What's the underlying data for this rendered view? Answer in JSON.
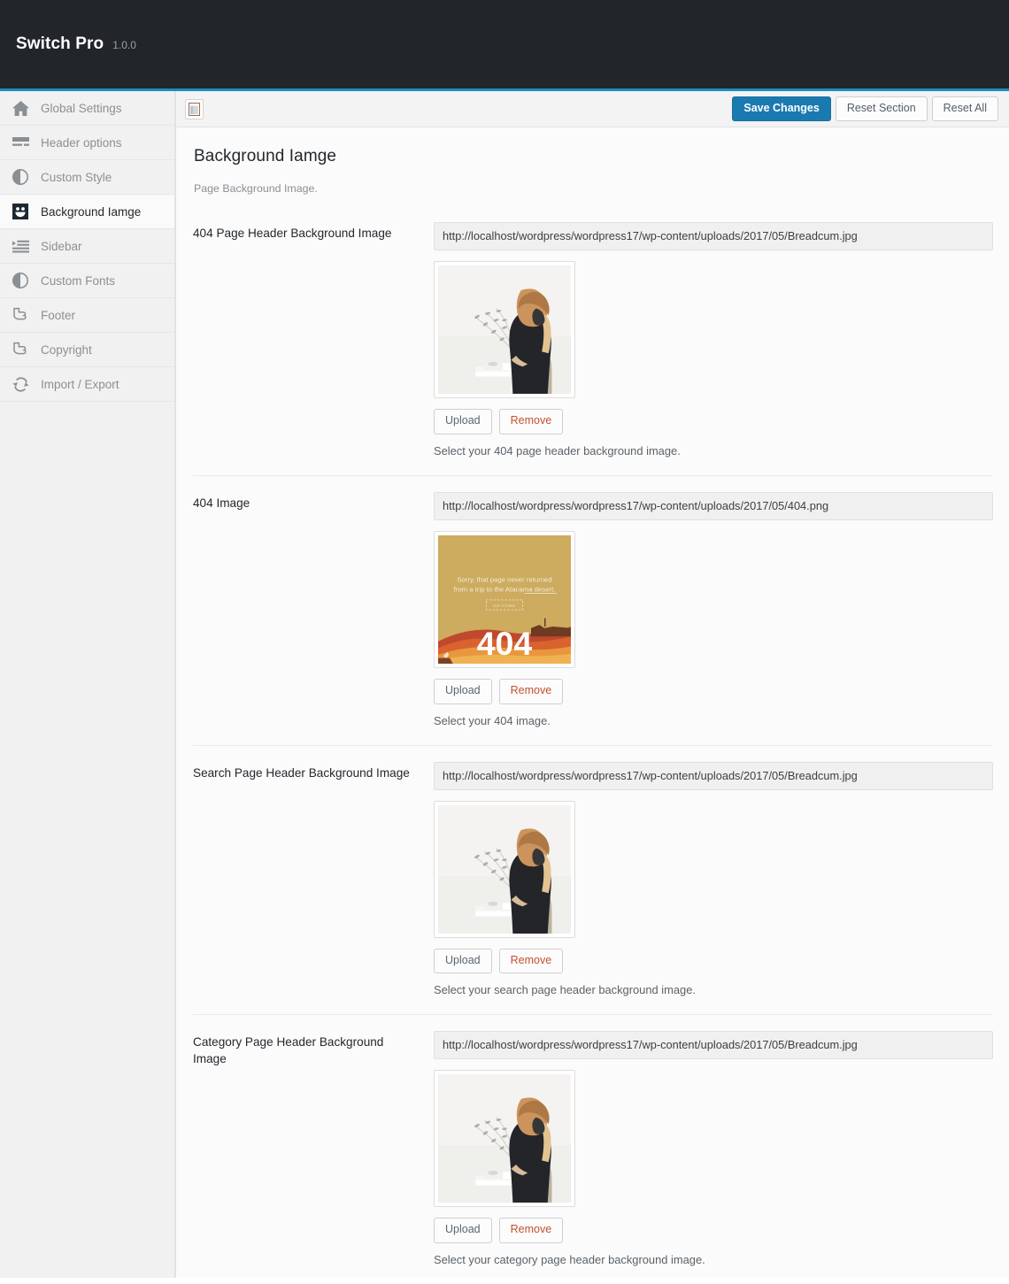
{
  "topbar": {
    "brand": "Switch Pro",
    "version": "1.0.0"
  },
  "colors": {
    "accent": "#1e8cbe",
    "primary_button": "#1a7ab0",
    "topbar_bg": "#22262a",
    "remove_text": "#c2502f",
    "sidebar_bg": "#f1f1f1",
    "content_bg": "#fbfbfb"
  },
  "sidebar": {
    "items": [
      {
        "label": "Global Settings",
        "icon": "home-icon",
        "active": false
      },
      {
        "label": "Header options",
        "icon": "header-bars-icon",
        "active": false
      },
      {
        "label": "Custom Style",
        "icon": "half-circle-icon",
        "active": false
      },
      {
        "label": "Background Iamge",
        "icon": "smiley-square-icon",
        "active": true
      },
      {
        "label": "Sidebar",
        "icon": "indent-list-icon",
        "active": false
      },
      {
        "label": "Custom Fonts",
        "icon": "half-circle-icon",
        "active": false
      },
      {
        "label": "Footer",
        "icon": "pointing-hand-icon",
        "active": false
      },
      {
        "label": "Copyright",
        "icon": "pointing-hand-icon",
        "active": false
      },
      {
        "label": "Import / Export",
        "icon": "sync-arrows-icon",
        "active": false
      }
    ]
  },
  "toolbar": {
    "expand_icon": "panel-layout-icon",
    "save_label": "Save Changes",
    "reset_section_label": "Reset Section",
    "reset_all_label": "Reset All"
  },
  "panel": {
    "title": "Background Iamge",
    "subtitle": "Page Background Image."
  },
  "buttons": {
    "upload": "Upload",
    "remove": "Remove"
  },
  "fields": [
    {
      "label": "404 Page Header Background Image",
      "url": "http://localhost/wordpress/wordpress17/wp-content/uploads/2017/05/Breadcum.jpg",
      "thumb": "desk-photo",
      "description": "Select your 404 page header background image."
    },
    {
      "label": "404 Image",
      "url": "http://localhost/wordpress/wordpress17/wp-content/uploads/2017/05/404.png",
      "thumb": "error-404-art",
      "description": "Select your 404 image."
    },
    {
      "label": "Search Page Header Background Image",
      "url": "http://localhost/wordpress/wordpress17/wp-content/uploads/2017/05/Breadcum.jpg",
      "thumb": "desk-photo",
      "description": "Select your search page header background image."
    },
    {
      "label": "Category Page Header Background Image",
      "url": "http://localhost/wordpress/wordpress17/wp-content/uploads/2017/05/Breadcum.jpg",
      "thumb": "desk-photo",
      "description": "Select your category page header background image."
    }
  ],
  "thumb_art": {
    "error_404": {
      "line1": "Sorry, that page never returned",
      "line2": "from a trip to the Atacama desert.",
      "button": "GO HOME",
      "big_number": "404"
    }
  }
}
